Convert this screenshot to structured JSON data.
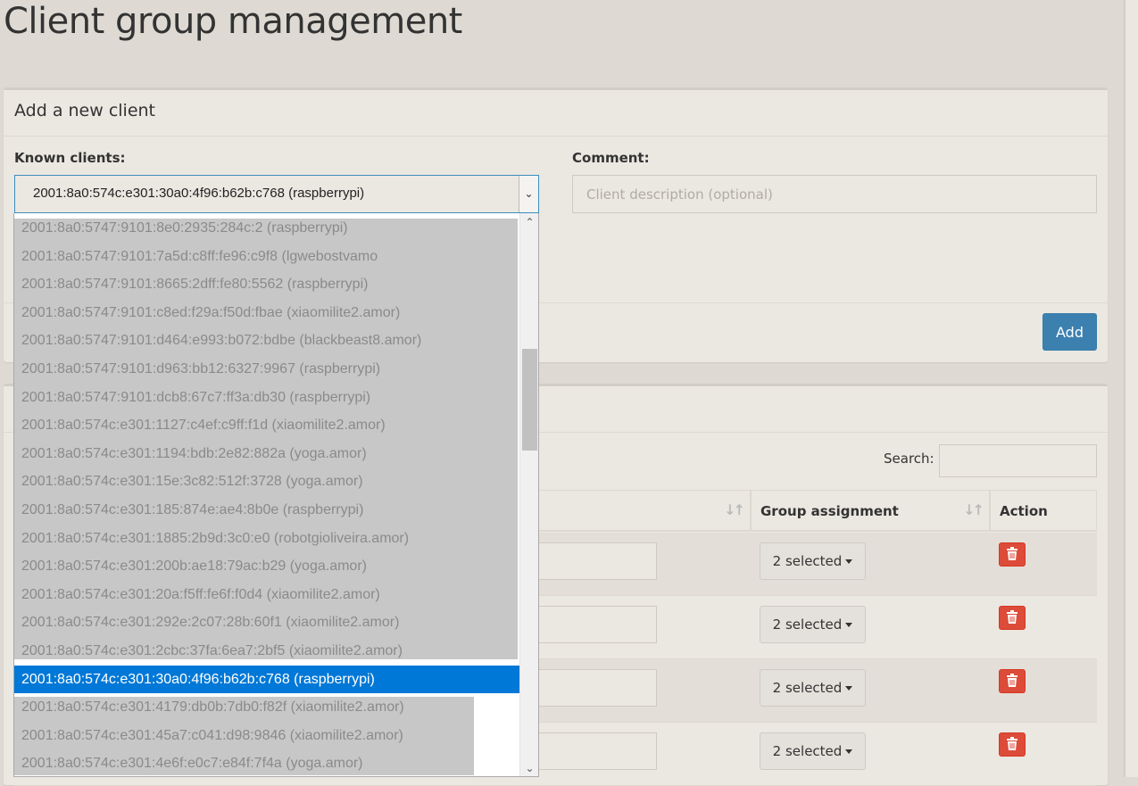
{
  "page": {
    "title": "Client group management"
  },
  "add_box": {
    "title": "Add a new client",
    "known_label": "Known clients:",
    "selected_client": "2001:8a0:574c:e301:30a0:4f96:b62b:c768 (raspberrypi)",
    "comment_label": "Comment:",
    "comment_placeholder": "Client description (optional)",
    "add_button": "Add"
  },
  "list_box": {
    "search_label": "Search:",
    "columns": [
      "Group assignment",
      "Action"
    ],
    "rows": [
      {
        "group": "2 selected"
      },
      {
        "group": "2 selected"
      },
      {
        "group": "2 selected"
      },
      {
        "group": "2 selected"
      }
    ]
  },
  "dropdown": {
    "options": [
      "2001:8a0:5747:9101:8e0:2935:284c:2 (raspberrypi)",
      "2001:8a0:5747:9101:7a5d:c8ff:fe96:c9f8 (lgwebostvamo",
      "2001:8a0:5747:9101:8665:2dff:fe80:5562 (raspberrypi)",
      "2001:8a0:5747:9101:c8ed:f29a:f50d:fbae (xiaomilite2.amor)",
      "2001:8a0:5747:9101:d464:e993:b072:bdbe (blackbeast8.amor)",
      "2001:8a0:5747:9101:d963:bb12:6327:9967 (raspberrypi)",
      "2001:8a0:5747:9101:dcb8:67c7:ff3a:db30 (raspberrypi)",
      "2001:8a0:574c:e301:1127:c4ef:c9ff:f1d (xiaomilite2.amor)",
      "2001:8a0:574c:e301:1194:bdb:2e82:882a (yoga.amor)",
      "2001:8a0:574c:e301:15e:3c82:512f:3728 (yoga.amor)",
      "2001:8a0:574c:e301:185:874e:ae4:8b0e (raspberrypi)",
      "2001:8a0:574c:e301:1885:2b9d:3c0:e0 (robotgioliveira.amor)",
      "2001:8a0:574c:e301:200b:ae18:79ac:b29 (yoga.amor)",
      "2001:8a0:574c:e301:20a:f5ff:fe6f:f0d4 (xiaomilite2.amor)",
      "2001:8a0:574c:e301:292e:2c07:28b:60f1 (xiaomilite2.amor)",
      "2001:8a0:574c:e301:2cbc:37fa:6ea7:2bf5 (xiaomilite2.amor)",
      "2001:8a0:574c:e301:30a0:4f96:b62b:c768 (raspberrypi)",
      "2001:8a0:574c:e301:4179:db0b:7db0:f82f (xiaomilite2.amor)",
      "2001:8a0:574c:e301:45a7:c041:d98:9846 (xiaomilite2.amor)",
      "2001:8a0:574c:e301:4e6f:e0c7:e84f:7f4a (yoga.amor)"
    ],
    "selected_index": 16
  }
}
